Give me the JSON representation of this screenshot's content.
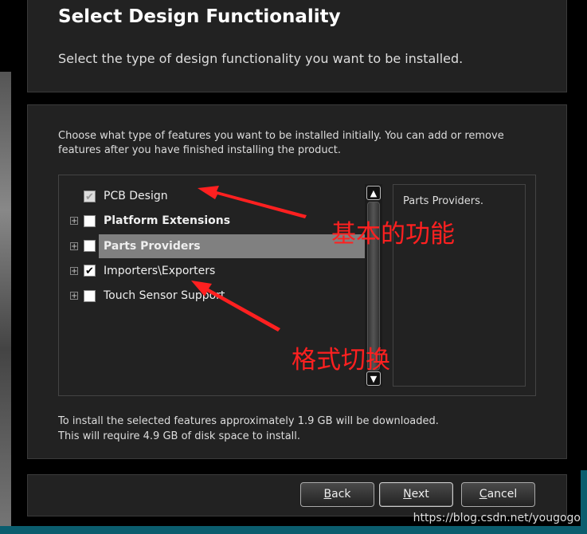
{
  "header": {
    "title": "Select Design Functionality",
    "subtitle": "Select the type of design functionality you want to be installed."
  },
  "intro": "Choose what type of features you want to be installed initially. You can add or remove features after you have finished installing the product.",
  "features": [
    {
      "label": "PCB Design",
      "checked": true,
      "disabled": true,
      "expandable": false,
      "bold": false
    },
    {
      "label": "Platform Extensions",
      "checked": false,
      "expandable": true,
      "bold": true
    },
    {
      "label": "Parts Providers",
      "checked": false,
      "expandable": true,
      "bold": true,
      "selected": true
    },
    {
      "label": "Importers\\Exporters",
      "checked": true,
      "expandable": true,
      "bold": false
    },
    {
      "label": "Touch Sensor Support",
      "checked": false,
      "expandable": true,
      "bold": false
    }
  ],
  "description": "Parts Providers.",
  "footer": {
    "line1": "To install the selected features approximately 1.9 GB will be downloaded.",
    "line2": "This will require 4.9 GB of disk space to install."
  },
  "buttons": {
    "back_u": "B",
    "back": "ack",
    "next_u": "N",
    "next": "ext",
    "cancel_u": "C",
    "cancel": "ancel"
  },
  "annotations": {
    "basic": "基本的功能",
    "format": "格式切换"
  },
  "watermark": "https://blog.csdn.net/yougogo",
  "colors": {
    "annotation": "#ff2020",
    "selection": "#808080"
  }
}
